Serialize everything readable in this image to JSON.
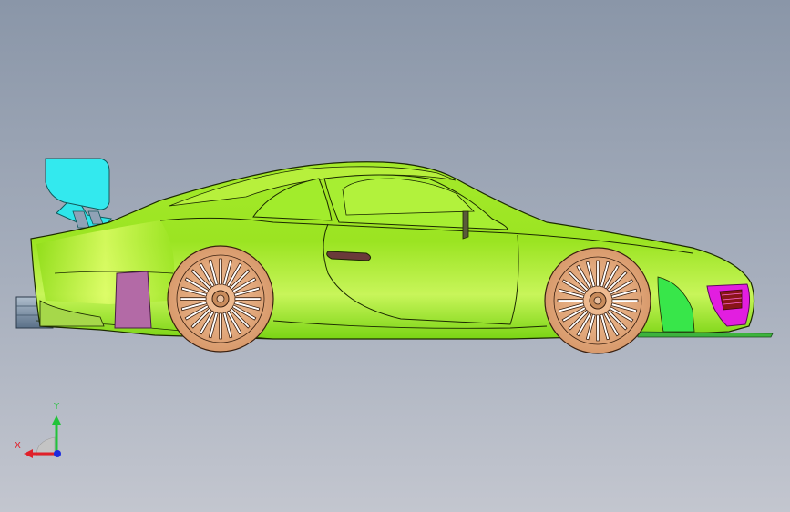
{
  "model": {
    "part_name": "race-car-side-view",
    "colors": {
      "body": "#8fe31a",
      "body_highlight": "#d8ff6a",
      "body_shadow": "#5fbf00",
      "wing": "#2ee6ea",
      "wheel": "#e3ad86",
      "wheel_hub": "#c98c5c",
      "tail_panel": "#b36aa6",
      "light_magenta": "#e21ee0",
      "exhaust": "#8fa2b6",
      "splitter": "#3db33d",
      "outline": "#1c2a00"
    }
  },
  "triad": {
    "x_label": "X",
    "y_label": "Y",
    "colors": {
      "x": "#e0202a",
      "y": "#22c33a",
      "z": "#1b2adf"
    }
  }
}
